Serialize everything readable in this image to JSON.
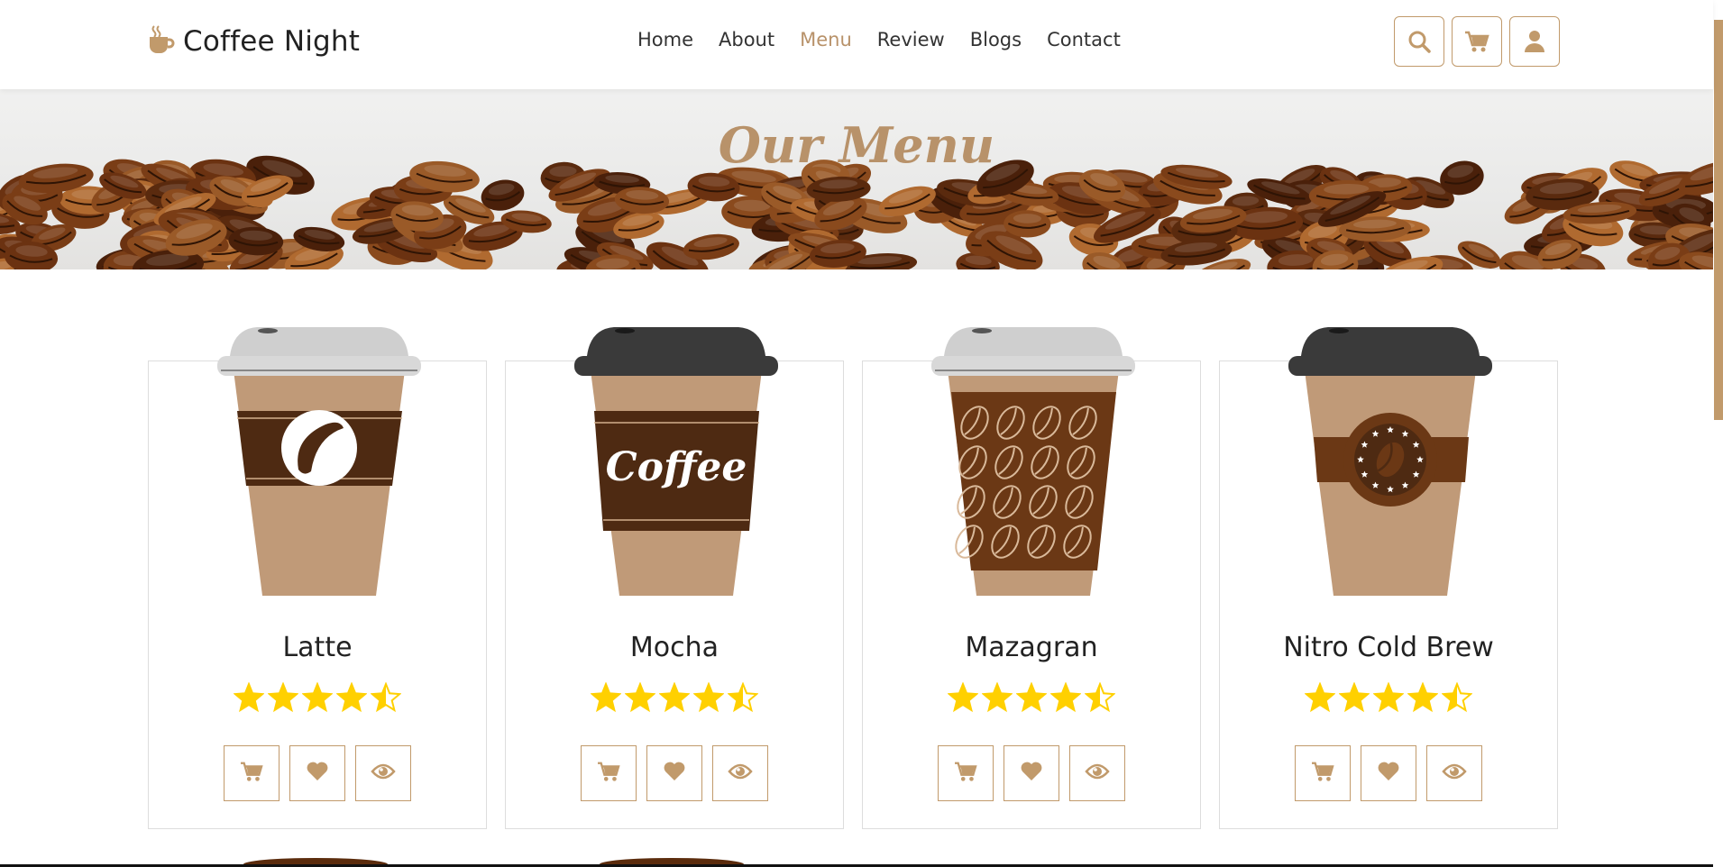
{
  "brand": {
    "name": "Coffee Night",
    "icon": "coffee-cup-icon",
    "color": "#c19a6b"
  },
  "nav": {
    "items": [
      {
        "label": "Home",
        "active": false
      },
      {
        "label": "About",
        "active": false
      },
      {
        "label": "Menu",
        "active": true
      },
      {
        "label": "Review",
        "active": false
      },
      {
        "label": "Blogs",
        "active": false
      },
      {
        "label": "Contact",
        "active": false
      }
    ]
  },
  "tools": [
    {
      "icon": "search-icon"
    },
    {
      "icon": "cart-icon"
    },
    {
      "icon": "user-icon"
    }
  ],
  "banner": {
    "title": "Our Menu"
  },
  "products": [
    {
      "name": "Latte",
      "rating": 4.5,
      "cup_lid": "#dadada",
      "cup_design": "bean-badge"
    },
    {
      "name": "Mocha",
      "rating": 4.5,
      "cup_lid": "#3a3a3a",
      "cup_design": "Coffee"
    },
    {
      "name": "Mazagran",
      "rating": 4.5,
      "cup_lid": "#dadada",
      "cup_design": "bean-pattern"
    },
    {
      "name": "Nitro Cold Brew",
      "rating": 4.5,
      "cup_lid": "#3a3a3a",
      "cup_design": "star-emblem"
    }
  ],
  "card_actions": [
    "cart-icon",
    "heart-icon",
    "eye-icon"
  ],
  "colors": {
    "accent": "#c19a6b",
    "star": "#ffd000",
    "sleeve": "#4e2a12",
    "cup": "#c09a78"
  }
}
